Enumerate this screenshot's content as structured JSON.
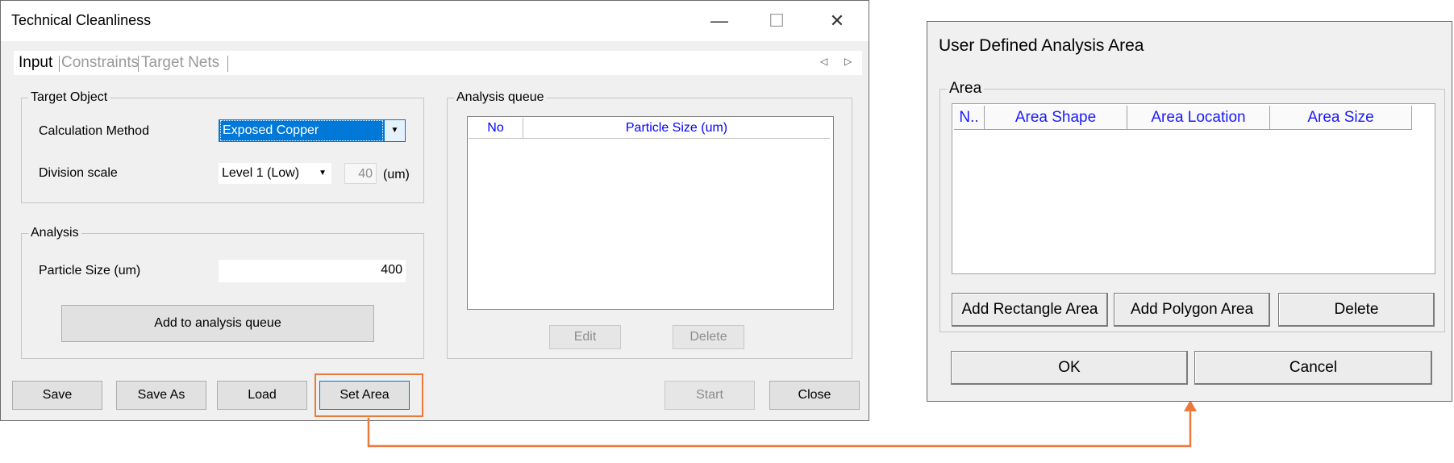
{
  "tech_window": {
    "title": "Technical Cleanliness",
    "controls": {
      "minimize": "—",
      "maximize": "☐",
      "close": "✕"
    },
    "tabs": [
      {
        "label": "Input",
        "active": true
      },
      {
        "label": "Constraints",
        "active": false
      },
      {
        "label": "Target Nets",
        "active": false
      }
    ],
    "tab_arrows": {
      "left": "◁",
      "right": "▷"
    },
    "target_object": {
      "group_label": "Target Object",
      "calc_method_label": "Calculation Method",
      "calc_method_value": "Exposed Copper",
      "division_scale_label": "Division scale",
      "division_scale_value": "Level 1 (Low)",
      "division_value": "40",
      "division_unit": "(um)"
    },
    "analysis": {
      "group_label": "Analysis",
      "particle_size_label": "Particle Size (um)",
      "particle_size_value": "400",
      "add_button": "Add to analysis queue"
    },
    "analysis_queue": {
      "group_label": "Analysis queue",
      "columns": [
        "No",
        "Particle Size (um)"
      ],
      "edit_button": "Edit",
      "delete_button": "Delete"
    },
    "bottom_buttons": {
      "save": "Save",
      "save_as": "Save As",
      "load": "Load",
      "set_area": "Set Area",
      "start": "Start",
      "close": "Close"
    }
  },
  "area_window": {
    "title": "User Defined Analysis Area",
    "group_label": "Area",
    "columns": [
      "N..",
      "Area Shape",
      "Area Location",
      "Area Size"
    ],
    "add_rect_button": "Add Rectangle Area",
    "add_polygon_button": "Add Polygon Area",
    "delete_button": "Delete",
    "ok_button": "OK",
    "cancel_button": "Cancel"
  },
  "colors": {
    "highlight": "#e87a3c",
    "selection": "#0078d7",
    "header_text": "#0000ff"
  }
}
